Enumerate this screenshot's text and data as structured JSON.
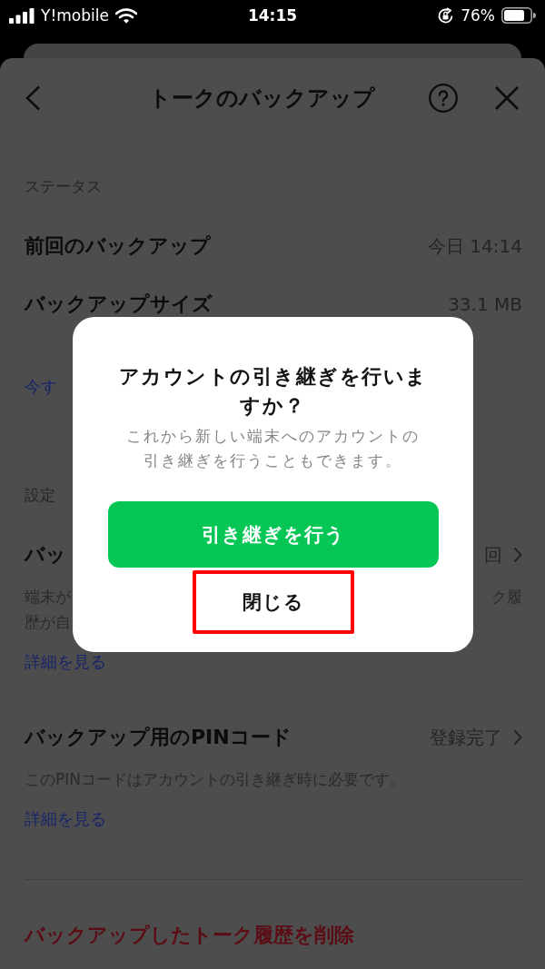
{
  "status_bar": {
    "carrier": "Y!mobile",
    "time": "14:15",
    "battery": "76%"
  },
  "header": {
    "title": "トークのバックアップ"
  },
  "sections": [
    {
      "label": "ステータス",
      "divider": false,
      "items": [
        {
          "kind": "row",
          "title": "前回のバックアップ",
          "value": "今日 14:14",
          "chevron": false
        },
        {
          "kind": "row",
          "title": "バックアップサイズ",
          "value": "33.1 MB",
          "chevron": false
        },
        {
          "kind": "link",
          "text": "今す"
        }
      ]
    },
    {
      "label": "設定",
      "divider": false,
      "items": [
        {
          "kind": "row",
          "title": "バッ",
          "value": "回",
          "chevron": true
        },
        {
          "kind": "description",
          "lines": [
            {
              "start": "端末が",
              "end": "ク履"
            },
            {
              "start": "歴が自"
            }
          ]
        },
        {
          "kind": "link",
          "text": "詳細を見る"
        },
        {
          "kind": "row",
          "title": "バックアップ用のPINコード",
          "value": "登録完了",
          "chevron": true
        },
        {
          "kind": "description",
          "lines": [
            {
              "start": "このPINコードはアカウントの引き継ぎ時に必要です。"
            }
          ]
        },
        {
          "kind": "link",
          "text": "詳細を見る"
        }
      ]
    },
    {
      "divider": true,
      "items": [
        {
          "kind": "danger",
          "text": "バックアップしたトーク履歴を削除"
        }
      ]
    }
  ],
  "dialog": {
    "title": "アカウントの引き継ぎを行いますか？",
    "message": "これから新しい端末へのアカウントの引き継ぎを行うこともできます。",
    "buttons": [
      {
        "label": "引き継ぎを行う",
        "kind": "primary",
        "highlighted": false
      },
      {
        "label": "閉じる",
        "kind": "plain",
        "highlighted": true
      }
    ]
  }
}
